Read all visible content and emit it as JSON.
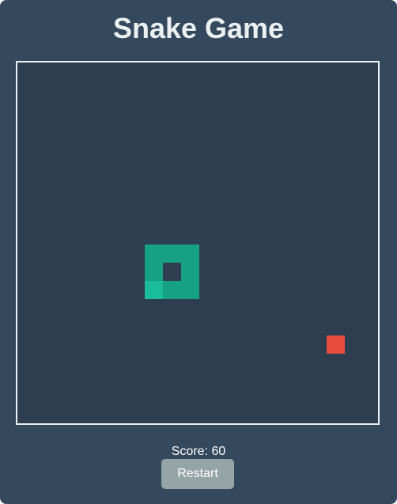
{
  "header": {
    "title": "Snake Game"
  },
  "game": {
    "grid": {
      "cols": 20,
      "rows": 20
    },
    "snake": {
      "head": [
        7,
        12
      ],
      "body": [
        [
          8,
          12
        ],
        [
          9,
          12
        ],
        [
          9,
          11
        ],
        [
          9,
          10
        ],
        [
          8,
          10
        ],
        [
          7,
          10
        ],
        [
          7,
          11
        ]
      ],
      "head_color": "#1abc9c",
      "body_color": "#16a085"
    },
    "food": {
      "cell": [
        17,
        15
      ],
      "color": "#e74c3c"
    }
  },
  "footer": {
    "score_text": "Score: 60",
    "restart_label": "Restart"
  },
  "colors": {
    "app_bg": "#34495e",
    "board_bg": "#2c3e50",
    "border": "#ecf0f1",
    "button_bg": "#95a5a6"
  }
}
